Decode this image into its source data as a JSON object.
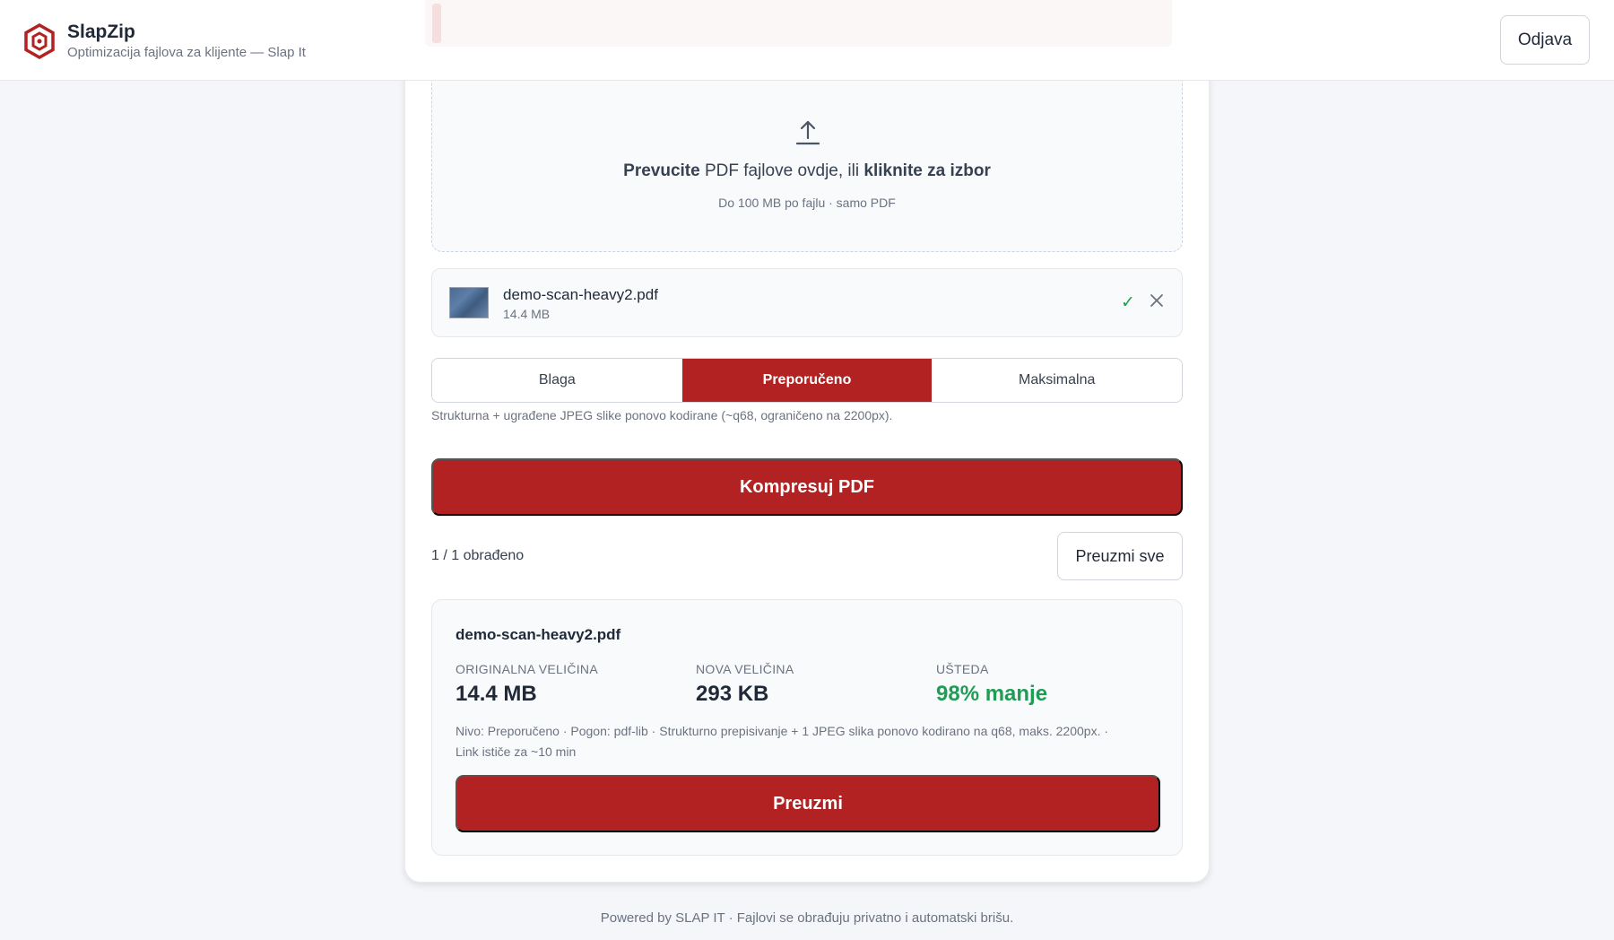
{
  "header": {
    "brand_title": "SlapZip",
    "brand_subtitle": "Optimizacija fajlova za klijente — Slap It",
    "logout_label": "Odjava",
    "brand_color": "#b22222"
  },
  "dropzone": {
    "text_bold_1": "Prevucite",
    "text_mid": " PDF fajlove ovdje, ili ",
    "text_bold_2": "kliknite za izbor",
    "hint": "Do 100 MB po fajlu · samo PDF",
    "icon": "upload-icon"
  },
  "file": {
    "name": "demo-scan-heavy2.pdf",
    "size": "14.4 MB",
    "status_icon": "check-icon",
    "status_symbol": "✓",
    "remove_icon": "close-icon"
  },
  "levels": {
    "options": [
      "Blaga",
      "Preporučeno",
      "Maksimalna"
    ],
    "selected": "Preporučeno",
    "description": "Strukturna + ugrađene JPEG slike ponovo kodirane (~q68, ograničeno na 2200px)."
  },
  "actions": {
    "compress_label": "Kompresuj PDF",
    "processed_text": "1 / 1 obrađeno",
    "download_all_label": "Preuzmi sve"
  },
  "result": {
    "name": "demo-scan-heavy2.pdf",
    "original_label": "ORIGINALNA VELIČINA",
    "original_value": "14.4 MB",
    "new_label": "NOVA VELIČINA",
    "new_value": "293 KB",
    "saving_label": "UŠTEDA",
    "saving_value": "98% manje",
    "details_line1": "Nivo: Preporučeno · Pogon: pdf-lib · Strukturno prepisivanje + 1 JPEG slika ponovo kodirano na q68, maks. 2200px. ·",
    "details_line2": "Link ističe za ~10 min",
    "download_label": "Preuzmi",
    "saving_color": "#1f9d55"
  },
  "footer": {
    "text": "Powered by SLAP IT · Fajlovi se obrađuju privatno i automatski brišu."
  }
}
